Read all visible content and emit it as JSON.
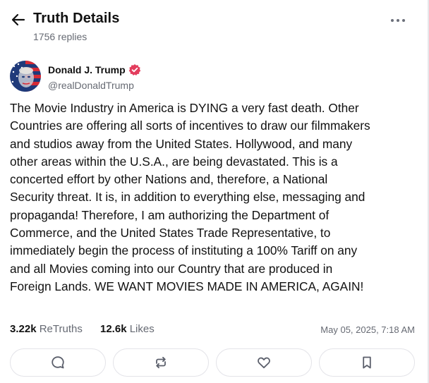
{
  "header": {
    "title": "Truth Details",
    "replies": "1756 replies",
    "back_icon": "arrow-left-icon",
    "more_icon": "more-horizontal-icon"
  },
  "author": {
    "name": "Donald J. Trump",
    "handle": "@realDonaldTrump",
    "verified_color": "#e33d5d",
    "avatar_colors": [
      "#1f3a7a",
      "#d62b36",
      "#ffffff"
    ]
  },
  "post": {
    "text": "The Movie Industry in America is DYING a very fast death. Other Countries are offering all sorts of incentives to draw our filmmakers and studios away from the United States. Hollywood, and many other areas within the U.S.A., are being devastated. This is a concerted effort by other Nations and, therefore, a National Security threat. It is, in addition to everything else, messaging and propaganda! Therefore, I am authorizing the Department of Commerce, and the United States Trade Representative, to immediately begin the process of instituting a 100% Tariff on any and all Movies coming into our Country that are produced in Foreign Lands. WE WANT MOVIES MADE IN AMERICA, AGAIN!",
    "lines": [
      "The Movie Industry in America is DYING a very fast death. Other",
      "Countries are offering all sorts of incentives to draw our filmmakers",
      "and studios away from the United States. Hollywood, and many",
      "other areas within the U.S.A., are being devastated. This is a",
      "concerted effort by other Nations and, therefore, a National",
      "Security threat. It is, in addition to everything else, messaging and",
      "propaganda! Therefore, I am authorizing the Department of",
      "Commerce, and the United States Trade Representative, to",
      "immediately begin the process of instituting a 100% Tariff on any",
      "and all Movies coming into our Country that are produced in",
      "Foreign Lands. WE WANT MOVIES MADE IN AMERICA, AGAIN!"
    ]
  },
  "stats": {
    "retruths_count": "3.22k",
    "retruths_label": "ReTruths",
    "likes_count": "12.6k",
    "likes_label": "Likes",
    "timestamp": "May 05, 2025, 7:18 AM"
  },
  "actions": [
    {
      "name": "reply",
      "icon": "comment-icon"
    },
    {
      "name": "retruth",
      "icon": "repost-icon"
    },
    {
      "name": "like",
      "icon": "heart-icon"
    },
    {
      "name": "bookmark",
      "icon": "bookmark-icon"
    }
  ],
  "colors": {
    "text": "#111111",
    "muted": "#666a73",
    "border": "#e3e3e8",
    "icon": "#5b5f6b"
  }
}
